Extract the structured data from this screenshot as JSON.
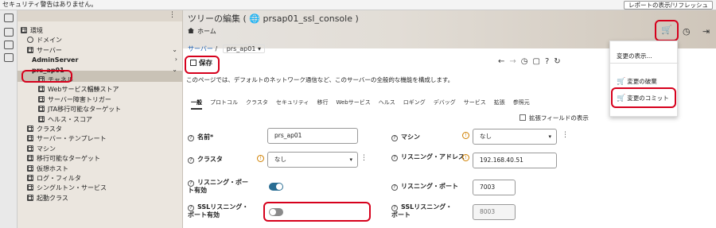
{
  "topbar": {
    "warning": "セキュリティ警告はありません。",
    "report_button": "レポートの表示/リフレッシュ"
  },
  "nav": {
    "items": [
      {
        "label": "環境",
        "icon": "grid-icon",
        "indent": 0,
        "expanded": true
      },
      {
        "label": "ドメイン",
        "icon": "globe-icon",
        "indent": 1
      },
      {
        "label": "サーバー",
        "icon": "grid-icon",
        "indent": 1,
        "expanded": true
      },
      {
        "label": "AdminServer",
        "icon": "",
        "indent": 2
      },
      {
        "label": "prs_ap01",
        "icon": "",
        "indent": 2,
        "selected": true
      },
      {
        "label": "チャネル",
        "icon": "grid-icon",
        "indent": 3
      },
      {
        "label": "Webサービス輻輳ストア",
        "icon": "grid-icon",
        "indent": 3
      },
      {
        "label": "サーバー障害トリガー",
        "icon": "grid-icon",
        "indent": 3
      },
      {
        "label": "JTA移行可能なターゲット",
        "icon": "grid-icon",
        "indent": 3
      },
      {
        "label": "ヘルス・スコア",
        "icon": "grid-icon",
        "indent": 3
      },
      {
        "label": "クラスタ",
        "icon": "grid-icon",
        "indent": 1
      },
      {
        "label": "サーバー・テンプレート",
        "icon": "grid-icon",
        "indent": 1
      },
      {
        "label": "マシン",
        "icon": "grid-icon",
        "indent": 1
      },
      {
        "label": "移行可能なターゲット",
        "icon": "grid-icon",
        "indent": 1
      },
      {
        "label": "仮想ホスト",
        "icon": "grid-icon",
        "indent": 1
      },
      {
        "label": "ログ・フィルタ",
        "icon": "grid-icon",
        "indent": 1
      },
      {
        "label": "シングルトン・サービス",
        "icon": "grid-icon",
        "indent": 1
      },
      {
        "label": "起動クラス",
        "icon": "grid-icon",
        "indent": 1
      }
    ]
  },
  "header": {
    "title": "ツリーの編集 ( 🌐 prsap01_ssl_console )",
    "home": "ホーム"
  },
  "breadcrumb": {
    "link": "サーバー",
    "sep": "/",
    "current": "prs_ap01 ▾"
  },
  "toolbar": {
    "save": "保存"
  },
  "description": "このページでは、デフォルトのネットワーク通信など、このサーバーの全般的な機能を構成します。",
  "tabs": [
    "一般",
    "プロトコル",
    "クラスタ",
    "セキュリティ",
    "移行",
    "Webサービス",
    "ヘルス",
    "ロギング",
    "デバッグ",
    "サービス",
    "拡張",
    "参照元"
  ],
  "extended_fields": "拡張フィールドの表示",
  "form": {
    "name_label": "名前*",
    "name_value": "prs_ap01",
    "machine_label": "マシン",
    "machine_value": "なし",
    "cluster_label": "クラスタ",
    "cluster_value": "なし",
    "listen_addr_label": "リスニング・アドレス",
    "listen_addr_value": "192.168.40.51",
    "listen_port_enabled_label": "リスニング・ポート有効",
    "listen_port_label": "リスニング・ポート",
    "listen_port_value": "7003",
    "ssl_port_enabled_label": "SSLリスニング・ポート有効",
    "ssl_port_label": "SSLリスニング・ポート",
    "ssl_port_value": "8003"
  },
  "menu": {
    "show_changes": "変更の表示...",
    "discard": "変更の破棄",
    "commit": "変更のコミット"
  },
  "colors": {
    "highlight": "#d6001c",
    "toggle_on": "#2a6e94",
    "link": "#1a5fb4"
  }
}
